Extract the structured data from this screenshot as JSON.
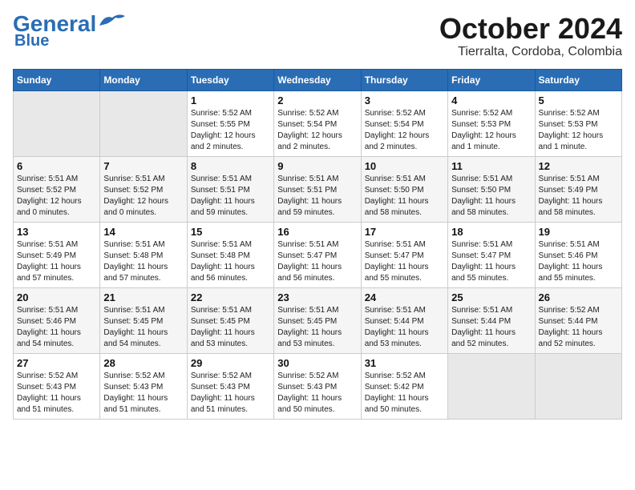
{
  "header": {
    "logo_line1": "General",
    "logo_line2": "Blue",
    "title": "October 2024",
    "subtitle": "Tierralta, Cordoba, Colombia"
  },
  "calendar": {
    "days_of_week": [
      "Sunday",
      "Monday",
      "Tuesday",
      "Wednesday",
      "Thursday",
      "Friday",
      "Saturday"
    ],
    "weeks": [
      [
        {
          "day": "",
          "info": ""
        },
        {
          "day": "",
          "info": ""
        },
        {
          "day": "1",
          "info": "Sunrise: 5:52 AM\nSunset: 5:55 PM\nDaylight: 12 hours\nand 2 minutes."
        },
        {
          "day": "2",
          "info": "Sunrise: 5:52 AM\nSunset: 5:54 PM\nDaylight: 12 hours\nand 2 minutes."
        },
        {
          "day": "3",
          "info": "Sunrise: 5:52 AM\nSunset: 5:54 PM\nDaylight: 12 hours\nand 2 minutes."
        },
        {
          "day": "4",
          "info": "Sunrise: 5:52 AM\nSunset: 5:53 PM\nDaylight: 12 hours\nand 1 minute."
        },
        {
          "day": "5",
          "info": "Sunrise: 5:52 AM\nSunset: 5:53 PM\nDaylight: 12 hours\nand 1 minute."
        }
      ],
      [
        {
          "day": "6",
          "info": "Sunrise: 5:51 AM\nSunset: 5:52 PM\nDaylight: 12 hours\nand 0 minutes."
        },
        {
          "day": "7",
          "info": "Sunrise: 5:51 AM\nSunset: 5:52 PM\nDaylight: 12 hours\nand 0 minutes."
        },
        {
          "day": "8",
          "info": "Sunrise: 5:51 AM\nSunset: 5:51 PM\nDaylight: 11 hours\nand 59 minutes."
        },
        {
          "day": "9",
          "info": "Sunrise: 5:51 AM\nSunset: 5:51 PM\nDaylight: 11 hours\nand 59 minutes."
        },
        {
          "day": "10",
          "info": "Sunrise: 5:51 AM\nSunset: 5:50 PM\nDaylight: 11 hours\nand 58 minutes."
        },
        {
          "day": "11",
          "info": "Sunrise: 5:51 AM\nSunset: 5:50 PM\nDaylight: 11 hours\nand 58 minutes."
        },
        {
          "day": "12",
          "info": "Sunrise: 5:51 AM\nSunset: 5:49 PM\nDaylight: 11 hours\nand 58 minutes."
        }
      ],
      [
        {
          "day": "13",
          "info": "Sunrise: 5:51 AM\nSunset: 5:49 PM\nDaylight: 11 hours\nand 57 minutes."
        },
        {
          "day": "14",
          "info": "Sunrise: 5:51 AM\nSunset: 5:48 PM\nDaylight: 11 hours\nand 57 minutes."
        },
        {
          "day": "15",
          "info": "Sunrise: 5:51 AM\nSunset: 5:48 PM\nDaylight: 11 hours\nand 56 minutes."
        },
        {
          "day": "16",
          "info": "Sunrise: 5:51 AM\nSunset: 5:47 PM\nDaylight: 11 hours\nand 56 minutes."
        },
        {
          "day": "17",
          "info": "Sunrise: 5:51 AM\nSunset: 5:47 PM\nDaylight: 11 hours\nand 55 minutes."
        },
        {
          "day": "18",
          "info": "Sunrise: 5:51 AM\nSunset: 5:47 PM\nDaylight: 11 hours\nand 55 minutes."
        },
        {
          "day": "19",
          "info": "Sunrise: 5:51 AM\nSunset: 5:46 PM\nDaylight: 11 hours\nand 55 minutes."
        }
      ],
      [
        {
          "day": "20",
          "info": "Sunrise: 5:51 AM\nSunset: 5:46 PM\nDaylight: 11 hours\nand 54 minutes."
        },
        {
          "day": "21",
          "info": "Sunrise: 5:51 AM\nSunset: 5:45 PM\nDaylight: 11 hours\nand 54 minutes."
        },
        {
          "day": "22",
          "info": "Sunrise: 5:51 AM\nSunset: 5:45 PM\nDaylight: 11 hours\nand 53 minutes."
        },
        {
          "day": "23",
          "info": "Sunrise: 5:51 AM\nSunset: 5:45 PM\nDaylight: 11 hours\nand 53 minutes."
        },
        {
          "day": "24",
          "info": "Sunrise: 5:51 AM\nSunset: 5:44 PM\nDaylight: 11 hours\nand 53 minutes."
        },
        {
          "day": "25",
          "info": "Sunrise: 5:51 AM\nSunset: 5:44 PM\nDaylight: 11 hours\nand 52 minutes."
        },
        {
          "day": "26",
          "info": "Sunrise: 5:52 AM\nSunset: 5:44 PM\nDaylight: 11 hours\nand 52 minutes."
        }
      ],
      [
        {
          "day": "27",
          "info": "Sunrise: 5:52 AM\nSunset: 5:43 PM\nDaylight: 11 hours\nand 51 minutes."
        },
        {
          "day": "28",
          "info": "Sunrise: 5:52 AM\nSunset: 5:43 PM\nDaylight: 11 hours\nand 51 minutes."
        },
        {
          "day": "29",
          "info": "Sunrise: 5:52 AM\nSunset: 5:43 PM\nDaylight: 11 hours\nand 51 minutes."
        },
        {
          "day": "30",
          "info": "Sunrise: 5:52 AM\nSunset: 5:43 PM\nDaylight: 11 hours\nand 50 minutes."
        },
        {
          "day": "31",
          "info": "Sunrise: 5:52 AM\nSunset: 5:42 PM\nDaylight: 11 hours\nand 50 minutes."
        },
        {
          "day": "",
          "info": ""
        },
        {
          "day": "",
          "info": ""
        }
      ]
    ]
  }
}
